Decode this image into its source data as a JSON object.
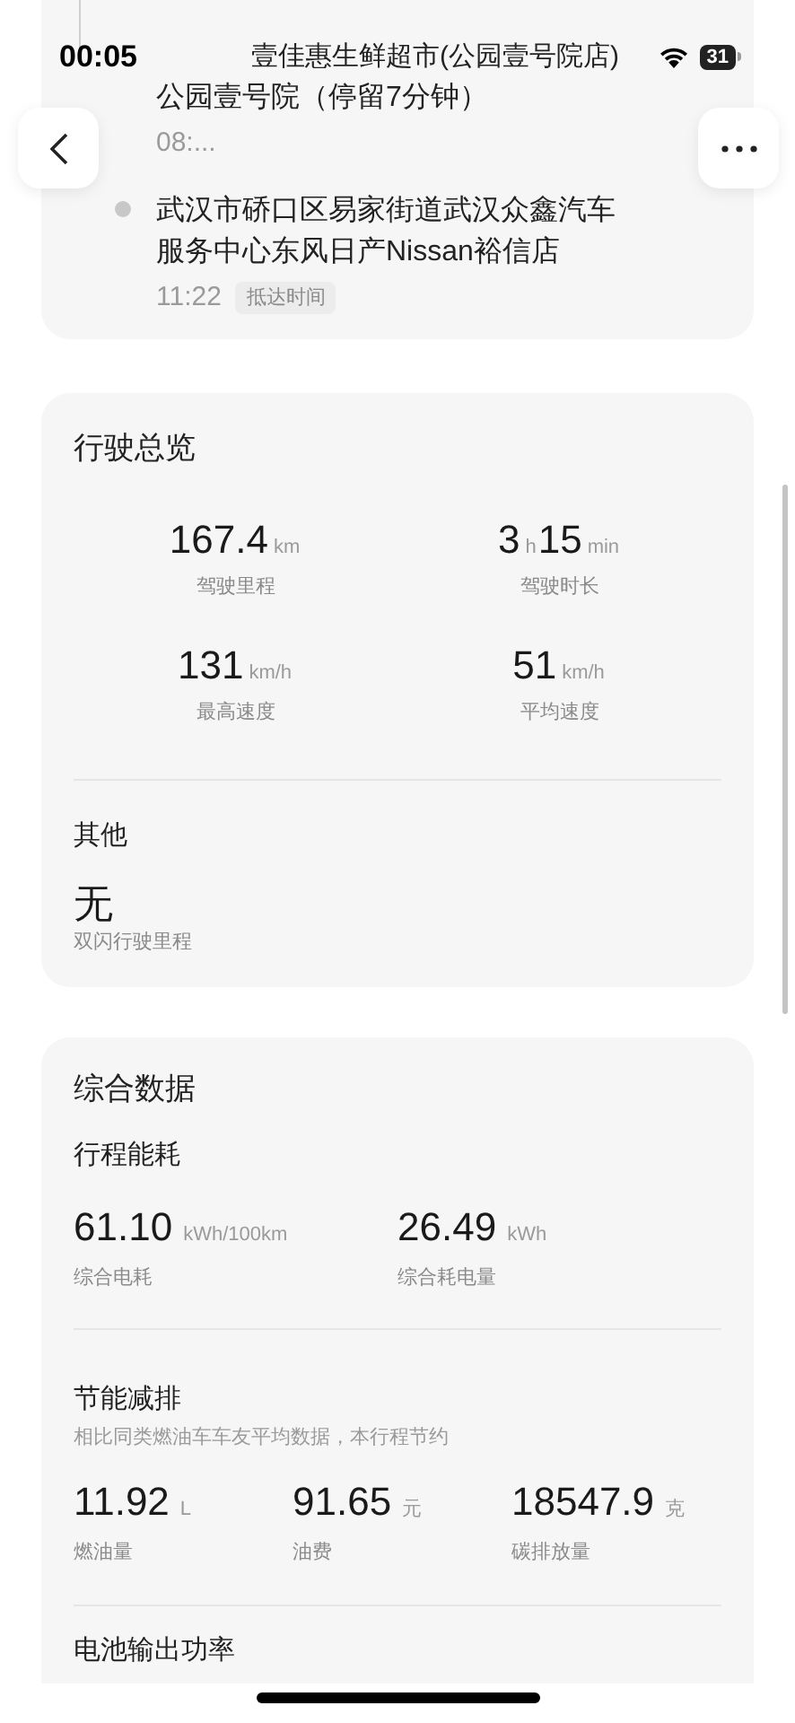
{
  "status_bar": {
    "time": "00:05",
    "battery": "31"
  },
  "route": {
    "stops": [
      {
        "lines": [
          "壹佳惠生鲜超市(公园壹号院店)",
          "公园壹号院（停留7分钟）"
        ],
        "time": "08:..."
      },
      {
        "lines": [
          "武汉市硚口区易家街道武汉众鑫汽车",
          "服务中心东风日产Nissan裕信店"
        ],
        "time": "11:22",
        "tag": "抵达时间"
      }
    ]
  },
  "overview": {
    "title": "行驶总览",
    "stats": [
      {
        "parts": [
          {
            "num": "167.4",
            "unit": "km"
          }
        ],
        "label": "驾驶里程"
      },
      {
        "parts": [
          {
            "num": "3",
            "unit": "h"
          },
          {
            "num": "15",
            "unit": "min"
          }
        ],
        "label": "驾驶时长"
      },
      {
        "parts": [
          {
            "num": "131",
            "unit": "km/h"
          }
        ],
        "label": "最高速度"
      },
      {
        "parts": [
          {
            "num": "51",
            "unit": "km/h"
          }
        ],
        "label": "平均速度"
      }
    ],
    "other": {
      "title": "其他",
      "value": "无",
      "label": "双闪行驶里程"
    }
  },
  "summary": {
    "title": "综合数据",
    "energy": {
      "title": "行程能耗",
      "stats": [
        {
          "num": "61.10",
          "unit": "kWh/100km",
          "label": "综合电耗"
        },
        {
          "num": "26.49",
          "unit": "kWh",
          "label": "综合耗电量"
        }
      ]
    },
    "saving": {
      "title": "节能减排",
      "subtitle": "相比同类燃油车车友平均数据，本行程节约",
      "stats": [
        {
          "num": "11.92",
          "unit": "L",
          "label": "燃油量"
        },
        {
          "num": "91.65",
          "unit": "元",
          "label": "油费"
        },
        {
          "num": "18547.9",
          "unit": "克",
          "label": "碳排放量"
        }
      ]
    },
    "next_section": {
      "title": "电池输出功率"
    }
  }
}
